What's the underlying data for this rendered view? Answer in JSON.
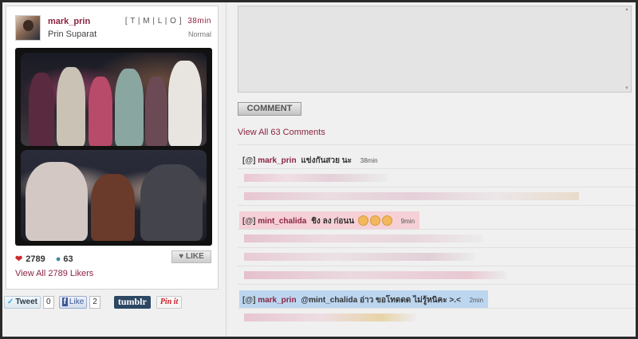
{
  "post": {
    "username": "mark_prin",
    "fullname": "Prin Suparat",
    "meta_links": "[ T | M | L | O ]",
    "time": "38min",
    "filter": "Normal",
    "likes": "2789",
    "comments_count": "63",
    "like_button": "LIKE",
    "view_likers": "View All 2789 Likers"
  },
  "share": {
    "tweet_label": "Tweet",
    "tweet_count": "0",
    "fb_icon": "f",
    "fb_label": "Like",
    "fb_count": "2",
    "tumblr_label": "tumblr",
    "pin_label": "Pin it"
  },
  "comment_form": {
    "button_label": "COMMENT",
    "view_all": "View All 63 Comments"
  },
  "comments": [
    {
      "tag": "[@]",
      "user": "mark_prin",
      "text": "แข่งกันสวย นะ",
      "time": "38min"
    },
    {
      "tag": "[@]",
      "user": "mint_chalida",
      "text": "ชิง ลง ก่อนน",
      "time": "9min"
    },
    {
      "tag": "[@]",
      "user": "mark_prin",
      "text": "@mint_chalida อ่าว ขอโทดดด ไม่รู้หนิคะ >.<",
      "time": "2min"
    }
  ],
  "colors": {
    "username": "#8b2340",
    "heart": "#cc2a2a",
    "highlight_pink": "#f5d0d6",
    "highlight_blue": "#bcd6f0"
  },
  "icons": {
    "heart": "heart-icon",
    "comment": "comment-bubble-icon",
    "twitter": "twitter-bird-icon"
  }
}
